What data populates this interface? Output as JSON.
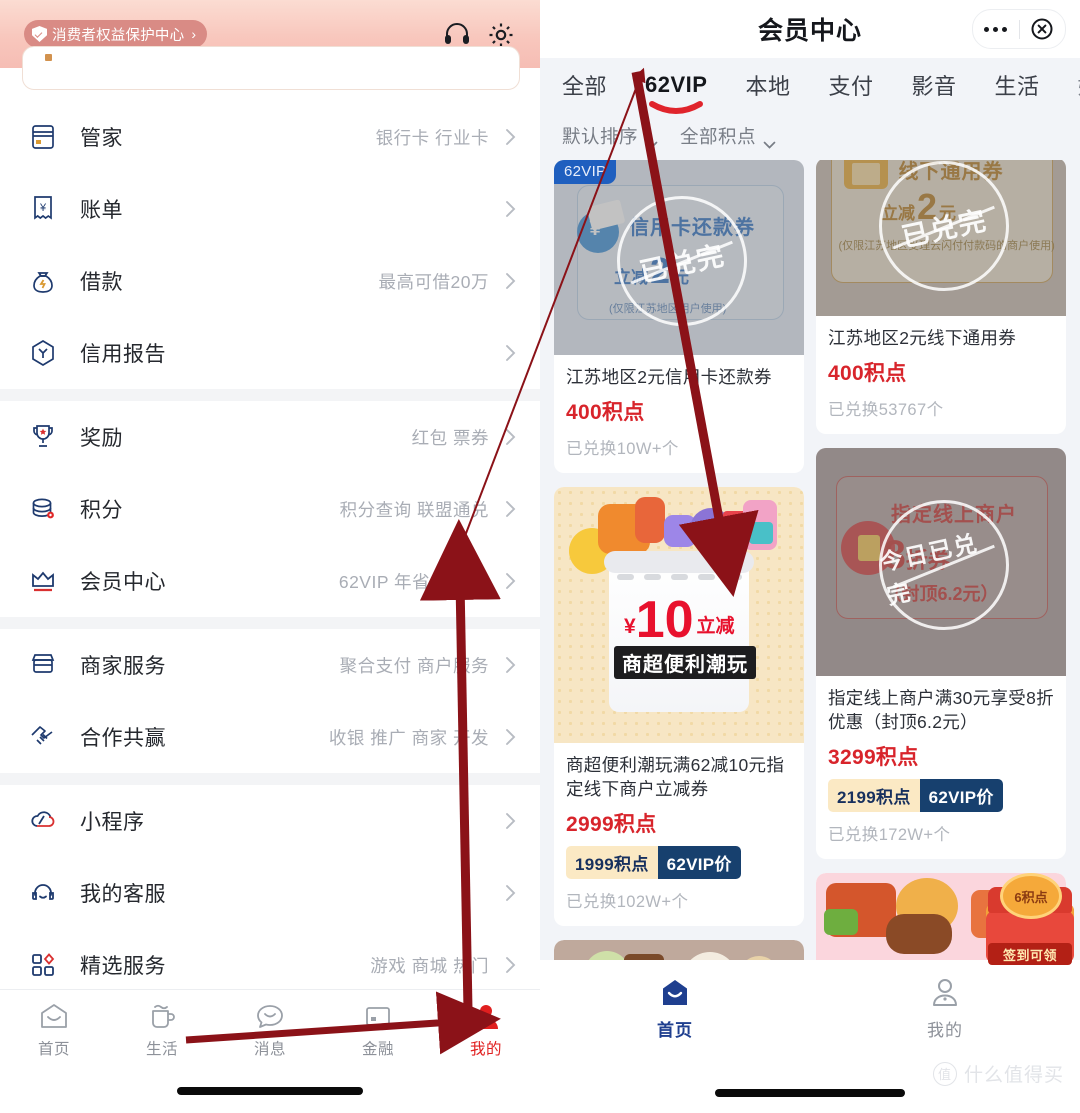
{
  "left_panel": {
    "header": {
      "consumer_pill": "消费者权益保护中心",
      "pill_arrow": "›",
      "support_icon": "headset-icon",
      "gear_icon": "gear-icon"
    },
    "groups": [
      {
        "rows": [
          {
            "icon": "bank-card-icon",
            "label": "管家",
            "sub": "银行卡 行业卡",
            "chevron": "›"
          },
          {
            "icon": "receipt-icon",
            "label": "账单",
            "sub": "",
            "chevron": "›"
          },
          {
            "icon": "money-bag-icon",
            "label": "借款",
            "sub": "最高可借20万",
            "chevron": "›"
          },
          {
            "icon": "credit-report-icon",
            "label": "信用报告",
            "sub": "",
            "chevron": "›"
          }
        ]
      },
      {
        "rows": [
          {
            "icon": "trophy-icon",
            "label": "奖励",
            "sub": "红包 票券",
            "chevron": "›"
          },
          {
            "icon": "points-icon",
            "label": "积分",
            "sub": "积分查询 联盟通兑",
            "chevron": "›"
          },
          {
            "icon": "crown-icon",
            "label": "会员中心",
            "sub": "62VIP 年省3874元",
            "chevron": "›"
          }
        ]
      },
      {
        "rows": [
          {
            "icon": "shop-icon",
            "label": "商家服务",
            "sub": "聚合支付 商户服务",
            "chevron": "›"
          },
          {
            "icon": "handshake-icon",
            "label": "合作共赢",
            "sub": "收银 推广 商家 开发",
            "chevron": "›"
          }
        ]
      },
      {
        "rows": [
          {
            "icon": "miniapp-icon",
            "label": "小程序",
            "sub": "",
            "chevron": "›"
          },
          {
            "icon": "headset-icon",
            "label": "我的客服",
            "sub": "",
            "chevron": "›"
          },
          {
            "icon": "grid-icon",
            "label": "精选服务",
            "sub": "游戏 商城 热门",
            "chevron": "›"
          }
        ]
      }
    ],
    "bottom_nav": {
      "items": [
        {
          "icon": "home-icon",
          "label": "首页",
          "active": false
        },
        {
          "icon": "cup-icon",
          "label": "生活",
          "active": false
        },
        {
          "icon": "message-icon",
          "label": "消息",
          "active": false
        },
        {
          "icon": "finance-icon",
          "label": "金融",
          "active": false
        },
        {
          "icon": "person-icon",
          "label": "我的",
          "active": true
        }
      ],
      "active_color": "#e01f1f"
    }
  },
  "right_panel": {
    "title": "会员中心",
    "capsule": {
      "more_icon": "more-dots-icon",
      "close_icon": "close-circle-icon"
    },
    "tabs": [
      {
        "label": "全部",
        "active": false
      },
      {
        "label": "62VIP",
        "active": true
      },
      {
        "label": "本地",
        "active": false
      },
      {
        "label": "支付",
        "active": false
      },
      {
        "label": "影音",
        "active": false
      },
      {
        "label": "生活",
        "active": false
      },
      {
        "label": "娱",
        "active": false
      }
    ],
    "filters": [
      {
        "label": "默认排序",
        "icon": "chevron-down-icon"
      },
      {
        "label": "全部积点",
        "icon": "chevron-down-icon"
      }
    ],
    "cards": {
      "left_column": [
        {
          "badge": "62VIP",
          "sold_out_stamp": "已兑完",
          "art_title": "信用卡还款券",
          "art_amount_prefix": "立减",
          "art_amount": "2",
          "art_amount_suffix": "元",
          "art_note": "(仅限江苏地区用户使用)",
          "name": "江苏地区2元信用卡还款券",
          "points": "400积点",
          "vip_points": "",
          "vip_tag": "",
          "sold": "已兑换10W+个"
        },
        {
          "badge": "",
          "sold_out_stamp": "",
          "art_price_yen": "¥",
          "art_price": "10",
          "art_price_suffix": "立减",
          "art_tag": "商超便利潮玩",
          "name": "商超便利潮玩满62减10元指定线下商户立减券",
          "points": "2999积点",
          "vip_points": "1999积点",
          "vip_tag": "62VIP价",
          "sold": "已兑换102W+个"
        }
      ],
      "right_column": [
        {
          "badge": "",
          "sold_out_stamp": "已兑完",
          "art_title": "线下通用券",
          "art_amount_prefix": "立减",
          "art_amount": "2",
          "art_amount_suffix": "元",
          "art_note": "(仅限江苏地区受理云闪付付款码的商户使用)",
          "name": "江苏地区2元线下通用券",
          "points": "400积点",
          "vip_points": "",
          "vip_tag": "",
          "sold": "已兑换53767个"
        },
        {
          "badge": "",
          "sold_out_stamp": "今日已兑完",
          "art_title": "指定线上商户",
          "art_amount": "8",
          "art_amount_suffix": "折券",
          "art_note": "（封顶6.2元）",
          "name": "指定线上商户满30元享受8折优惠（封顶6.2元）",
          "points": "3299积点",
          "vip_points": "2199积点",
          "vip_tag": "62VIP价",
          "sold": "已兑换172W+个"
        }
      ]
    },
    "chest_promo": {
      "points": "6积点",
      "cta": "签到可领"
    },
    "bottom_nav": {
      "items": [
        {
          "icon": "home-icon",
          "label": "首页",
          "active": true
        },
        {
          "icon": "person-icon",
          "label": "我的",
          "active": false
        }
      ],
      "active_color": "#1f3f8f"
    },
    "watermark": {
      "mark": "值",
      "text": "什么值得买"
    }
  },
  "annotations": {
    "accent_color": "#8b1218",
    "arrows": [
      {
        "name": "arrow-to-62vip-tab",
        "desc": "from member-center row to 62VIP tab"
      },
      {
        "name": "arrow-to-coupon-card",
        "desc": "from 62VIP tab down to coupon card"
      },
      {
        "name": "arrow-to-my-tab",
        "desc": "from member-center sub-text to 我的 tab"
      },
      {
        "name": "arrow-horizontal-to-my-tab",
        "desc": "horizontal arrow pointing at 我的 tab"
      }
    ],
    "underline_62vip": "red underline beneath 62VIP tab"
  }
}
